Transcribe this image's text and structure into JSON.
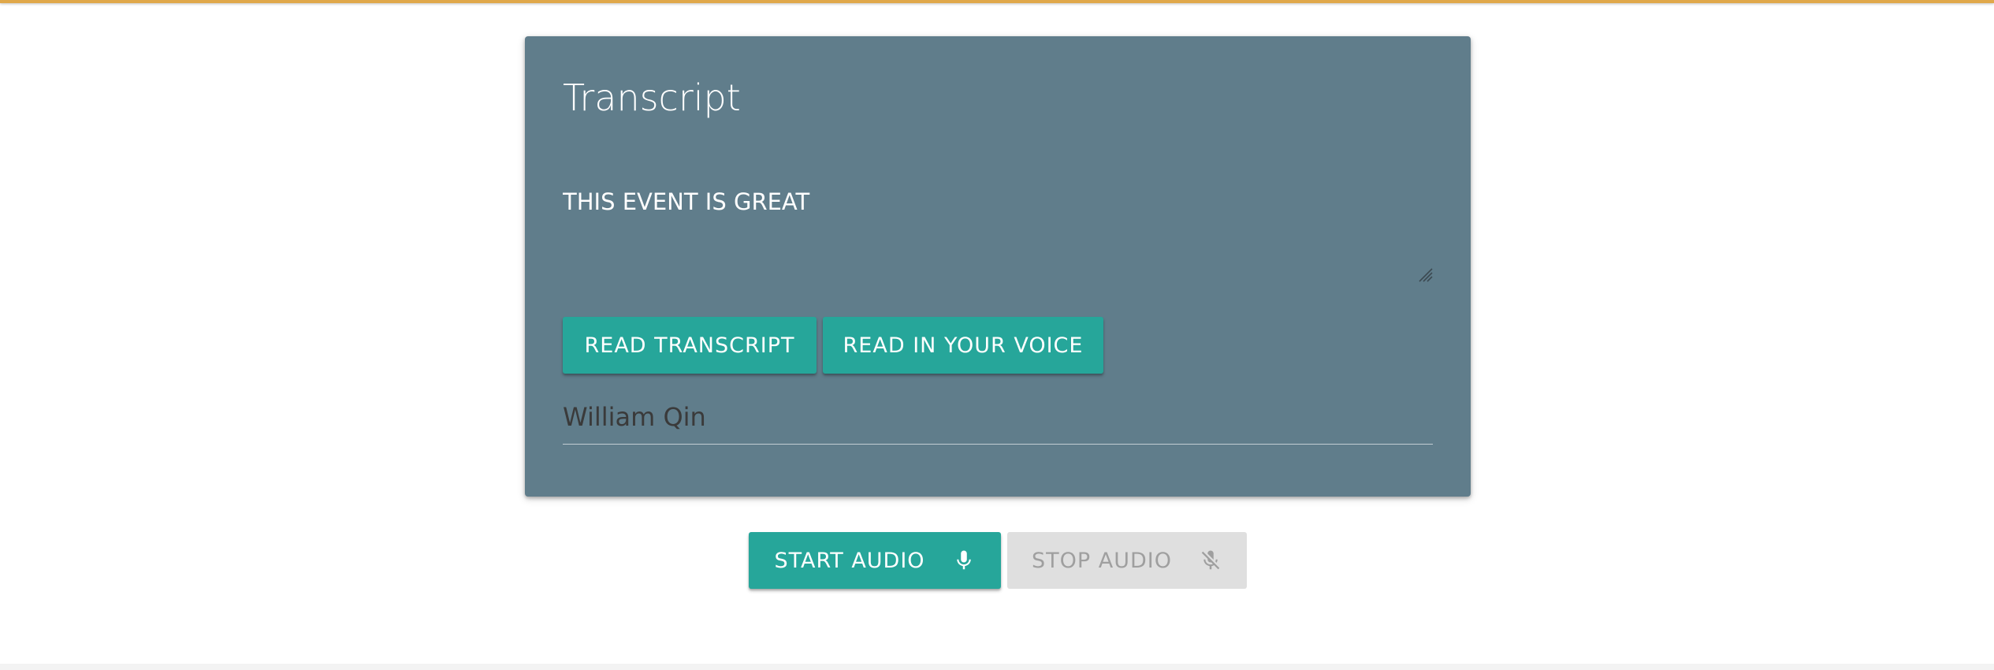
{
  "card": {
    "title": "Transcript",
    "transcript_text": "THIS EVENT IS GREAT",
    "read_transcript_label": "READ TRANSCRIPT",
    "read_voice_label": "READ IN YOUR VOICE",
    "name_value": "William Qin"
  },
  "controls": {
    "start_label": "START AUDIO",
    "start_icon": "microphone-icon",
    "stop_label": "STOP AUDIO",
    "stop_icon": "microphone-off-icon",
    "stop_disabled": true
  },
  "colors": {
    "card_bg": "#607d8b",
    "accent": "#26a69a",
    "top_bar": "#e0a84a",
    "disabled_bg": "#dfdfdf",
    "disabled_text": "#9f9f9f"
  }
}
